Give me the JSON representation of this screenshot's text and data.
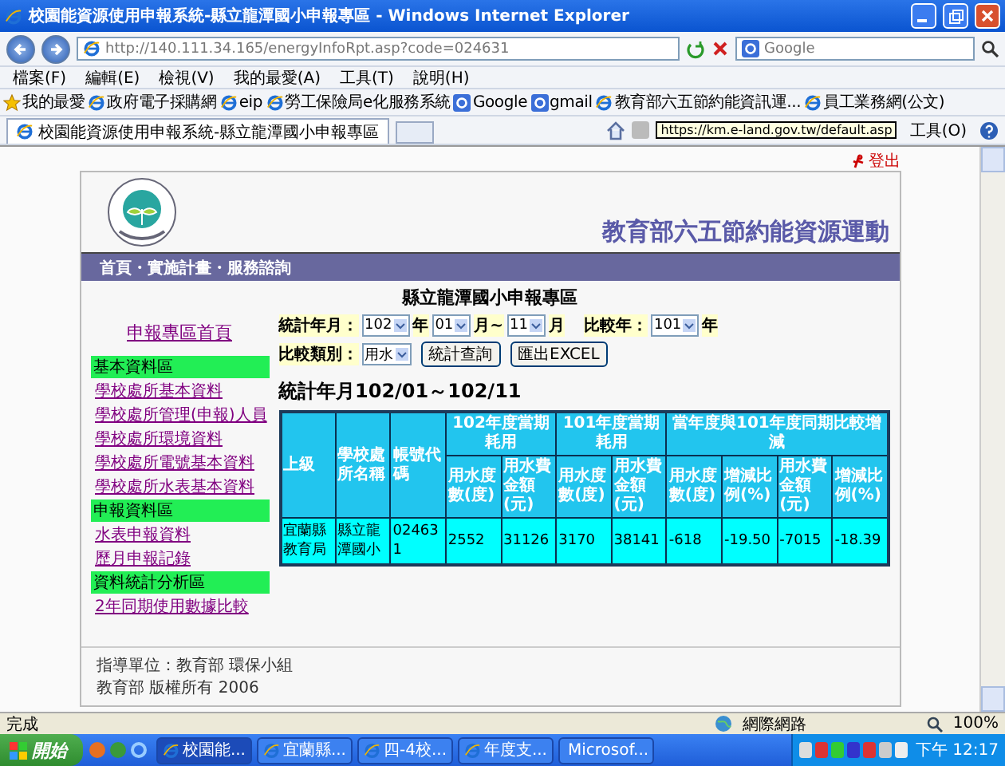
{
  "window": {
    "title": "校園能資源使用申報系統-縣立龍潭國小申報專區 - Windows Internet Explorer"
  },
  "address_bar": {
    "url": "http://140.111.34.165/energyInfoRpt.asp?code=024631",
    "search_placeholder": "Google"
  },
  "menu": [
    "檔案(F)",
    "編輯(E)",
    "檢視(V)",
    "我的最愛(A)",
    "工具(T)",
    "說明(H)"
  ],
  "favorites": {
    "label": "我的最愛",
    "items": [
      {
        "label": "政府電子採購網",
        "kind": "page"
      },
      {
        "label": "eip",
        "kind": "page"
      },
      {
        "label": "勞工保險局e化服務系統",
        "kind": "page"
      },
      {
        "label": "Google",
        "kind": "search"
      },
      {
        "label": "gmail",
        "kind": "search"
      },
      {
        "label": "教育部六五節約能資訊運...",
        "kind": "page"
      },
      {
        "label": "員工業務網(公文)",
        "kind": "page"
      }
    ]
  },
  "tabs": [
    {
      "label": "校園能資源使用申報系統-縣立龍潭國小申報專區",
      "selected": true
    }
  ],
  "command_bar": {
    "link_tooltip": "https://km.e-land.gov.tw/default.asp",
    "tools": "工具(O)"
  },
  "page": {
    "logout": "登出",
    "header_title": "教育部六五節約能資源運動",
    "nav": "首頁・實施計畫・服務諮詢",
    "subtitle": "縣立龍潭國小申報專區",
    "sidebar": {
      "home_link": "申報專區首頁",
      "sections": [
        {
          "title": "基本資料區",
          "links": [
            "學校處所基本資料",
            "學校處所管理(申報)人員",
            "學校處所環境資料",
            "學校處所電號基本資料",
            "學校處所水表基本資料"
          ]
        },
        {
          "title": "申報資料區",
          "links": [
            "水表申報資料",
            "歷月申報記錄"
          ]
        },
        {
          "title": "資料統計分析區",
          "links": [
            "2年同期使用數據比較"
          ]
        }
      ]
    },
    "filters": {
      "period_label": "統計年月：",
      "year": "102",
      "year_unit": "年",
      "month_from": "01",
      "month_sep": "月~",
      "month_to": "11",
      "month_unit": "月",
      "compare_label": "比較年：",
      "compare_year": "101",
      "compare_unit": "年",
      "category_label": "比較類別：",
      "category": "用水",
      "buttons": [
        "統計查詢",
        "匯出EXCEL"
      ]
    },
    "stat_title": "統計年月102/01～102/11",
    "table": {
      "columns": [
        "上級",
        "學校處所名稱",
        "帳號代碼"
      ],
      "groups": [
        {
          "label": "102年度當期耗用",
          "columns": [
            "用水度數(度)",
            "用水費金額(元)"
          ]
        },
        {
          "label": "101年度當期耗用",
          "columns": [
            "用水度數(度)",
            "用水費金額(元)"
          ]
        },
        {
          "label": "當年度與101年度同期比較增減",
          "columns": [
            "用水度數(度)",
            "增減比例(%)",
            "用水費金額(元)",
            "增減比例(%)"
          ]
        }
      ],
      "rows": [
        [
          "宜蘭縣教育局",
          "縣立龍潭國小",
          "024631",
          "2552",
          "31126",
          "3170",
          "38141",
          "-618",
          "-19.50",
          "-7015",
          "-18.39"
        ]
      ]
    },
    "footer": [
      "指導單位：教育部 環保小組",
      "教育部 版權所有 2006"
    ]
  },
  "status_bar": {
    "text": "完成",
    "zone": "網際網路",
    "zoom": "100%"
  },
  "taskbar": {
    "start": "開始",
    "tasks": [
      {
        "label": "校園能...",
        "selected": true
      },
      {
        "label": "宜蘭縣...",
        "selected": false
      },
      {
        "label": "四-4校...",
        "selected": false
      },
      {
        "label": "年度支...",
        "selected": false
      },
      {
        "label": "Microsof...",
        "selected": false
      }
    ],
    "clock": "下午 12:17"
  }
}
